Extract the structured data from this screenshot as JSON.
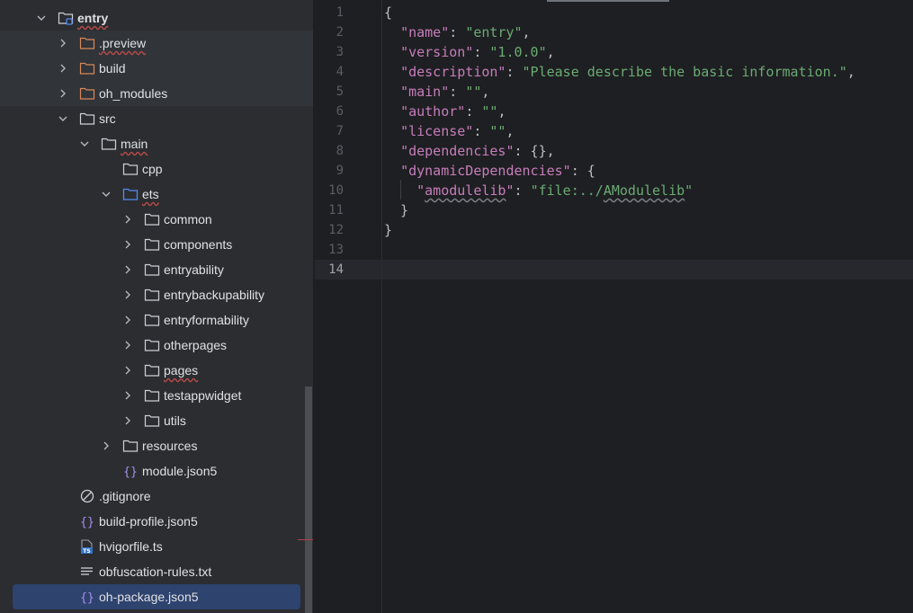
{
  "project_tree": {
    "items": [
      {
        "name": "entry",
        "bold": true,
        "depth": 0,
        "chevron": "down",
        "icon": "module-folder-icon"
      },
      {
        "name": ".preview",
        "depth": 1,
        "chevron": "right",
        "icon": "folder-excluded-icon"
      },
      {
        "name": "build",
        "depth": 1,
        "chevron": "right",
        "icon": "folder-excluded-icon"
      },
      {
        "name": "oh_modules",
        "depth": 1,
        "chevron": "right",
        "icon": "folder-excluded-icon"
      },
      {
        "name": "src",
        "depth": 1,
        "chevron": "down",
        "icon": "folder-icon"
      },
      {
        "name": "main",
        "depth": 2,
        "chevron": "down",
        "icon": "folder-icon"
      },
      {
        "name": "cpp",
        "depth": 3,
        "chevron": "none",
        "icon": "folder-icon"
      },
      {
        "name": "ets",
        "depth": 3,
        "chevron": "down",
        "icon": "folder-source-icon"
      },
      {
        "name": "common",
        "depth": 4,
        "chevron": "right",
        "icon": "folder-icon"
      },
      {
        "name": "components",
        "depth": 4,
        "chevron": "right",
        "icon": "folder-icon"
      },
      {
        "name": "entryability",
        "depth": 4,
        "chevron": "right",
        "icon": "folder-icon"
      },
      {
        "name": "entrybackupability",
        "depth": 4,
        "chevron": "right",
        "icon": "folder-icon"
      },
      {
        "name": "entryformability",
        "depth": 4,
        "chevron": "right",
        "icon": "folder-icon"
      },
      {
        "name": "otherpages",
        "depth": 4,
        "chevron": "right",
        "icon": "folder-icon"
      },
      {
        "name": "pages",
        "depth": 4,
        "chevron": "right",
        "icon": "folder-icon"
      },
      {
        "name": "testappwidget",
        "depth": 4,
        "chevron": "right",
        "icon": "folder-icon"
      },
      {
        "name": "utils",
        "depth": 4,
        "chevron": "right",
        "icon": "folder-icon"
      },
      {
        "name": "resources",
        "depth": 3,
        "chevron": "right",
        "icon": "folder-icon"
      },
      {
        "name": "module.json5",
        "depth": 3,
        "chevron": "none",
        "icon": "json-file-icon"
      },
      {
        "name": ".gitignore",
        "depth": 1,
        "chevron": "none",
        "icon": "gitignore-icon"
      },
      {
        "name": "build-profile.json5",
        "depth": 1,
        "chevron": "none",
        "icon": "json-file-icon"
      },
      {
        "name": "hvigorfile.ts",
        "depth": 1,
        "chevron": "none",
        "icon": "typescript-file-icon"
      },
      {
        "name": "obfuscation-rules.txt",
        "depth": 1,
        "chevron": "none",
        "icon": "text-file-icon"
      },
      {
        "name": "oh-package.json5",
        "depth": 1,
        "chevron": "none",
        "icon": "json-file-icon",
        "selected": true
      }
    ]
  },
  "editor": {
    "line_numbers": [
      "1",
      "2",
      "3",
      "4",
      "5",
      "6",
      "7",
      "8",
      "9",
      "10",
      "11",
      "12",
      "13",
      "14"
    ],
    "current_line": "14",
    "lines": [
      [
        {
          "t": "{",
          "c": "p"
        }
      ],
      [
        {
          "t": "  ",
          "c": "p"
        },
        {
          "t": "\"name\"",
          "c": "k"
        },
        {
          "t": ": ",
          "c": "p"
        },
        {
          "t": "\"entry\"",
          "c": "s"
        },
        {
          "t": ",",
          "c": "p"
        }
      ],
      [
        {
          "t": "  ",
          "c": "p"
        },
        {
          "t": "\"version\"",
          "c": "k"
        },
        {
          "t": ": ",
          "c": "p"
        },
        {
          "t": "\"1.0.0\"",
          "c": "s"
        },
        {
          "t": ",",
          "c": "p"
        }
      ],
      [
        {
          "t": "  ",
          "c": "p"
        },
        {
          "t": "\"description\"",
          "c": "k"
        },
        {
          "t": ": ",
          "c": "p"
        },
        {
          "t": "\"Please describe the basic information.\"",
          "c": "s"
        },
        {
          "t": ",",
          "c": "p"
        }
      ],
      [
        {
          "t": "  ",
          "c": "p"
        },
        {
          "t": "\"main\"",
          "c": "k"
        },
        {
          "t": ": ",
          "c": "p"
        },
        {
          "t": "\"\"",
          "c": "s"
        },
        {
          "t": ",",
          "c": "p"
        }
      ],
      [
        {
          "t": "  ",
          "c": "p"
        },
        {
          "t": "\"author\"",
          "c": "k"
        },
        {
          "t": ": ",
          "c": "p"
        },
        {
          "t": "\"\"",
          "c": "s"
        },
        {
          "t": ",",
          "c": "p"
        }
      ],
      [
        {
          "t": "  ",
          "c": "p"
        },
        {
          "t": "\"license\"",
          "c": "k"
        },
        {
          "t": ": ",
          "c": "p"
        },
        {
          "t": "\"\"",
          "c": "s"
        },
        {
          "t": ",",
          "c": "p"
        }
      ],
      [
        {
          "t": "  ",
          "c": "p"
        },
        {
          "t": "\"dependencies\"",
          "c": "k"
        },
        {
          "t": ": {},",
          "c": "p"
        }
      ],
      [
        {
          "t": "  ",
          "c": "p"
        },
        {
          "t": "\"dynamicDependencies\"",
          "c": "k"
        },
        {
          "t": ": {",
          "c": "p"
        }
      ],
      [
        {
          "t": "    ",
          "c": "p"
        },
        {
          "t": "\"",
          "c": "k"
        },
        {
          "t": "amodulelib",
          "c": "k",
          "w": true
        },
        {
          "t": "\"",
          "c": "k"
        },
        {
          "t": ": ",
          "c": "p"
        },
        {
          "t": "\"file:../",
          "c": "s"
        },
        {
          "t": "AModulelib",
          "c": "s",
          "w": true
        },
        {
          "t": "\"",
          "c": "s"
        }
      ],
      [
        {
          "t": "  }",
          "c": "p"
        }
      ],
      [
        {
          "t": "}",
          "c": "p"
        }
      ],
      [],
      []
    ]
  }
}
